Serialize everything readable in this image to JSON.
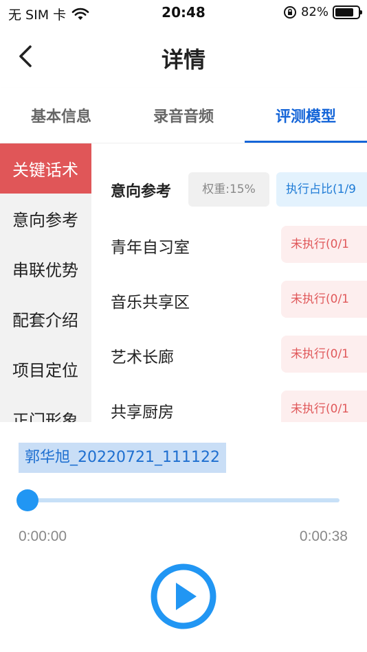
{
  "status_bar": {
    "carrier": "无 SIM 卡",
    "time": "20:48",
    "battery": "82%",
    "battery_level": 0.82
  },
  "nav": {
    "title": "详情"
  },
  "tabs": [
    {
      "label": "基本信息",
      "active": false
    },
    {
      "label": "录音音频",
      "active": false
    },
    {
      "label": "评测模型",
      "active": true
    }
  ],
  "side_nav": [
    {
      "label": "关键话术",
      "active": true
    },
    {
      "label": "意向参考",
      "active": false
    },
    {
      "label": "串联优势",
      "active": false
    },
    {
      "label": "配套介绍",
      "active": false
    },
    {
      "label": "项目定位",
      "active": false
    },
    {
      "label": "正门形象",
      "active": false
    }
  ],
  "content": {
    "group": {
      "title": "意向参考",
      "weight": "权重:15%",
      "ratio": "执行占比(1/9"
    },
    "rows": [
      {
        "name": "青年自习室",
        "status": "未执行(0/1"
      },
      {
        "name": "音乐共享区",
        "status": "未执行(0/1"
      },
      {
        "name": "艺术长廊",
        "status": "未执行(0/1"
      },
      {
        "name": "共享厨房",
        "status": "未执行(0/1"
      }
    ]
  },
  "player": {
    "file_name": "郭华旭_20220721_111122",
    "current_time": "0:00:00",
    "total_time": "0:00:38",
    "progress": 0
  },
  "colors": {
    "accent": "#1565d8",
    "active_side": "#e05658",
    "badge_red_text": "#e0585a",
    "player_blue": "#2196f3"
  }
}
